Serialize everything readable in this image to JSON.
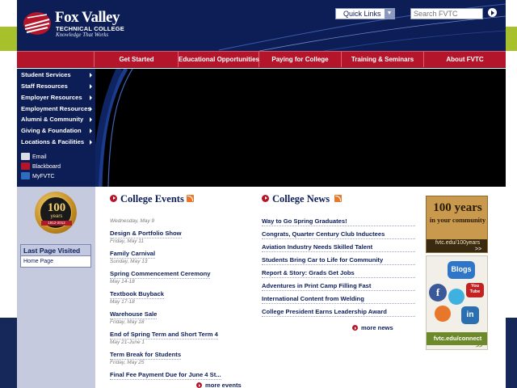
{
  "header": {
    "logo": {
      "name": "Fox Valley",
      "subtitle": "TECHNICAL COLLEGE",
      "tagline": "Knowledge That Works"
    },
    "quick_links": {
      "label": "Quick Links"
    },
    "search": {
      "placeholder": "Search FVTC"
    }
  },
  "topnav": [
    {
      "label": "Get Started"
    },
    {
      "label": "Educational Opportunities"
    },
    {
      "label": "Paying for College"
    },
    {
      "label": "Training & Seminars"
    },
    {
      "label": "About FVTC"
    }
  ],
  "sidebar": {
    "items": [
      {
        "label": "Student Services"
      },
      {
        "label": "Staff Resources"
      },
      {
        "label": "Employer Resources"
      },
      {
        "label": "Employment Resources"
      },
      {
        "label": "Alumni & Community"
      },
      {
        "label": "Giving & Foundation"
      },
      {
        "label": "Locations & Facilities"
      }
    ],
    "tools": [
      {
        "label": "Email",
        "icon": "email-icon",
        "color": "#d9dde8"
      },
      {
        "label": "Blackboard",
        "icon": "blackboard-icon",
        "color": "#b4152b"
      },
      {
        "label": "MyFVTC",
        "icon": "myfvtc-icon",
        "color": "#2f6cc0"
      }
    ]
  },
  "seal": {
    "number": "100",
    "word": "years",
    "range": "1912-2012"
  },
  "last_page": {
    "title": "Last Page Visited",
    "link": "Home Page"
  },
  "events": {
    "heading": "College Events",
    "items": [
      {
        "date": "Wednesday, May 9",
        "title": "Design & Portfolio Show"
      },
      {
        "date": "Friday, May 11",
        "title": "Family Carnival"
      },
      {
        "date": "Sunday, May 13",
        "title": "Spring Commencement Ceremony"
      },
      {
        "date": "May 14-18",
        "title": "Textbook Buyback"
      },
      {
        "date": "May 17-18",
        "title": "Warehouse Sale"
      },
      {
        "date": "Friday, May 18",
        "title": "End of Spring Term and Short Term 4"
      },
      {
        "date": "May 21-June 1",
        "title": "Term Break for Students"
      },
      {
        "date": "Friday, May 25",
        "title": "Final Fee Payment Due for June 4 St..."
      }
    ],
    "more": "more events"
  },
  "news": {
    "heading": "College News",
    "items": [
      "Way to Go Spring Graduates!",
      "Congrats, Quarter Century Club Inductees",
      "Aviation Industry Needs Skilled Talent",
      "Students Bring Car to Life for Community",
      "Report & Story: Grads Get Jobs",
      "Adventures in Print Camp Filling Fast",
      "International Content from Welding",
      "College President Earns Leadership Award"
    ],
    "more": "more news"
  },
  "promos": {
    "years": {
      "big": "100 years",
      "mid": "in your community",
      "url": "fvtc.edu/100years",
      "arrow": ">>"
    },
    "social": {
      "blogs": "Blogs",
      "youtube": "You Tube",
      "url": "fvtc.edu/connect",
      "arrow": ">>"
    }
  },
  "colors": {
    "navy": "#0d1e57",
    "red": "#b4152b",
    "lime": "#a6c12b"
  }
}
